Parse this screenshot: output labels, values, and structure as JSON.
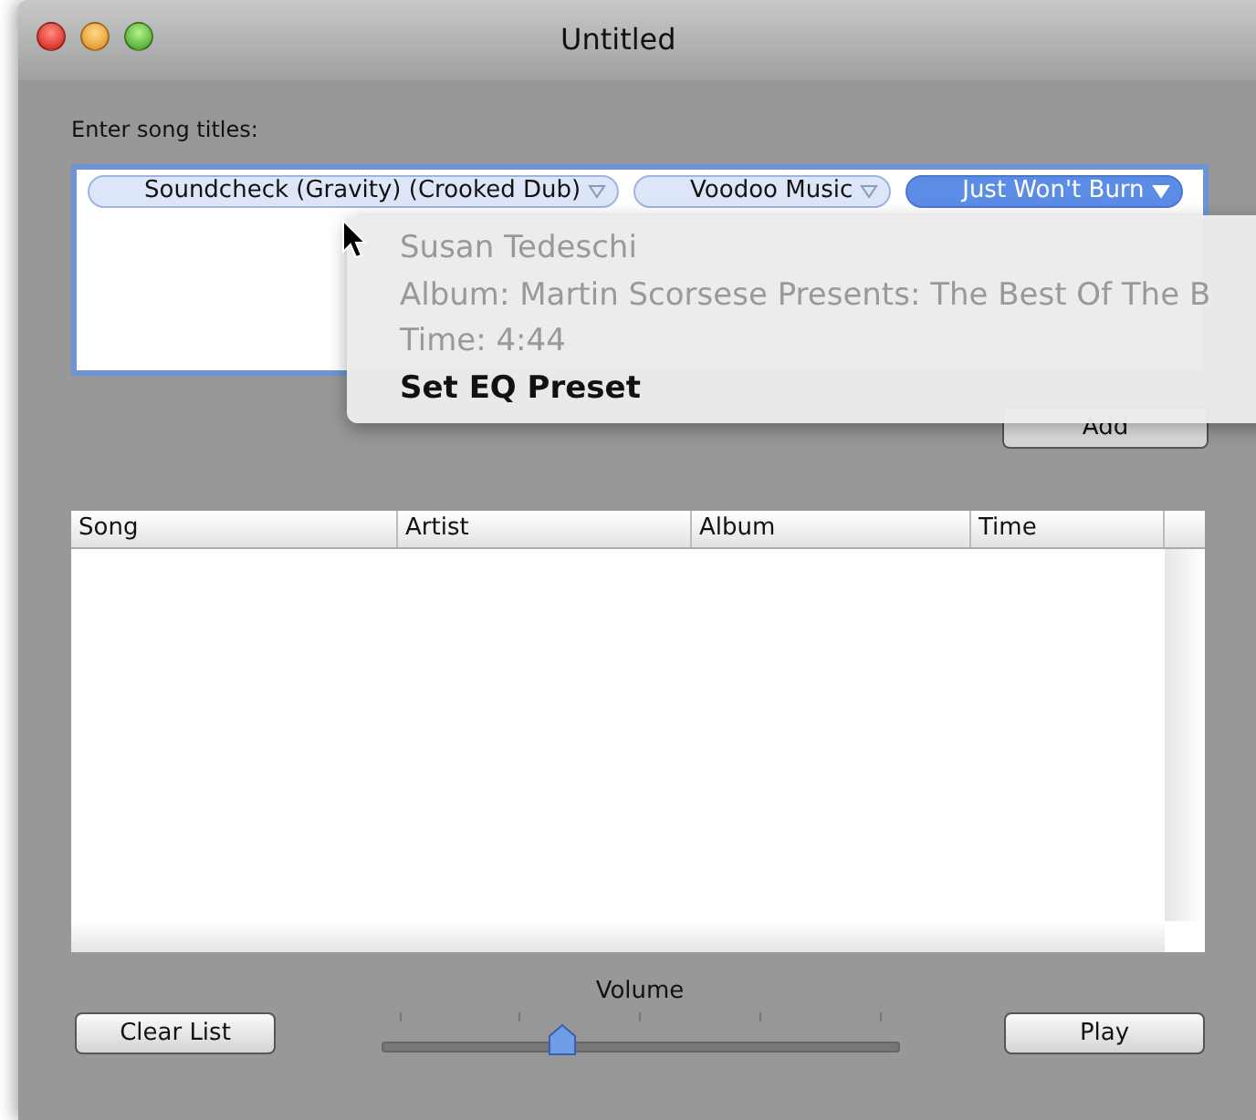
{
  "window": {
    "title": "Untitled"
  },
  "song_field": {
    "label": "Enter song titles:",
    "tokens": [
      {
        "text": "Soundcheck (Gravity) (Crooked Dub)",
        "selected": false
      },
      {
        "text": "Voodoo Music",
        "selected": false
      },
      {
        "text": "Just Won't Burn",
        "selected": true
      }
    ]
  },
  "popover": {
    "lines": [
      {
        "text": "Susan Tedeschi",
        "kind": "info"
      },
      {
        "text": "Album: Martin Scorsese Presents: The Best Of The B",
        "kind": "info"
      },
      {
        "text": "Time: 4:44",
        "kind": "info"
      },
      {
        "text": "Set EQ Preset",
        "kind": "action"
      }
    ]
  },
  "add_button": "Add",
  "table": {
    "columns": [
      "Song",
      "Artist",
      "Album",
      "Time"
    ]
  },
  "clear_button": "Clear List",
  "volume": {
    "label": "Volume",
    "level": 0.35
  },
  "play_button": "Play"
}
